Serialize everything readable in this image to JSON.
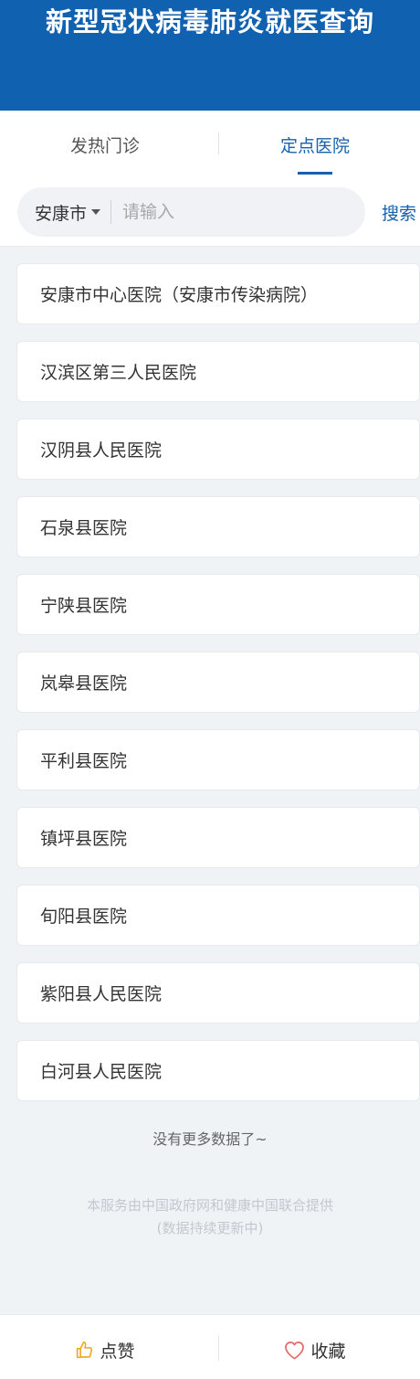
{
  "header": {
    "title": "新型冠状病毒肺炎就医查询"
  },
  "tabs": [
    {
      "label": "发热门诊",
      "active": false
    },
    {
      "label": "定点医院",
      "active": true
    }
  ],
  "search": {
    "city": "安康市",
    "placeholder": "请输入",
    "value": "",
    "button_label": "搜索"
  },
  "hospitals": [
    "安康市中心医院（安康市传染病院）",
    "汉滨区第三人民医院",
    "汉阴县人民医院",
    "石泉县医院",
    "宁陕县医院",
    "岚皋县医院",
    "平利县医院",
    "镇坪县医院",
    "旬阳县医院",
    "紫阳县人民医院",
    "白河县人民医院"
  ],
  "status": {
    "no_more": "没有更多数据了~"
  },
  "footer": {
    "line1": "本服务由中国政府网和健康中国联合提供",
    "line2": "(数据持续更新中)"
  },
  "bottom_bar": {
    "like_label": "点赞",
    "favorite_label": "收藏",
    "like_icon": "thumbs-up-icon",
    "favorite_icon": "heart-icon",
    "like_icon_color": "#f0a51f",
    "favorite_icon_color": "#e46a6a"
  },
  "colors": {
    "brand": "#1161b1",
    "accent": "#1561ad"
  }
}
